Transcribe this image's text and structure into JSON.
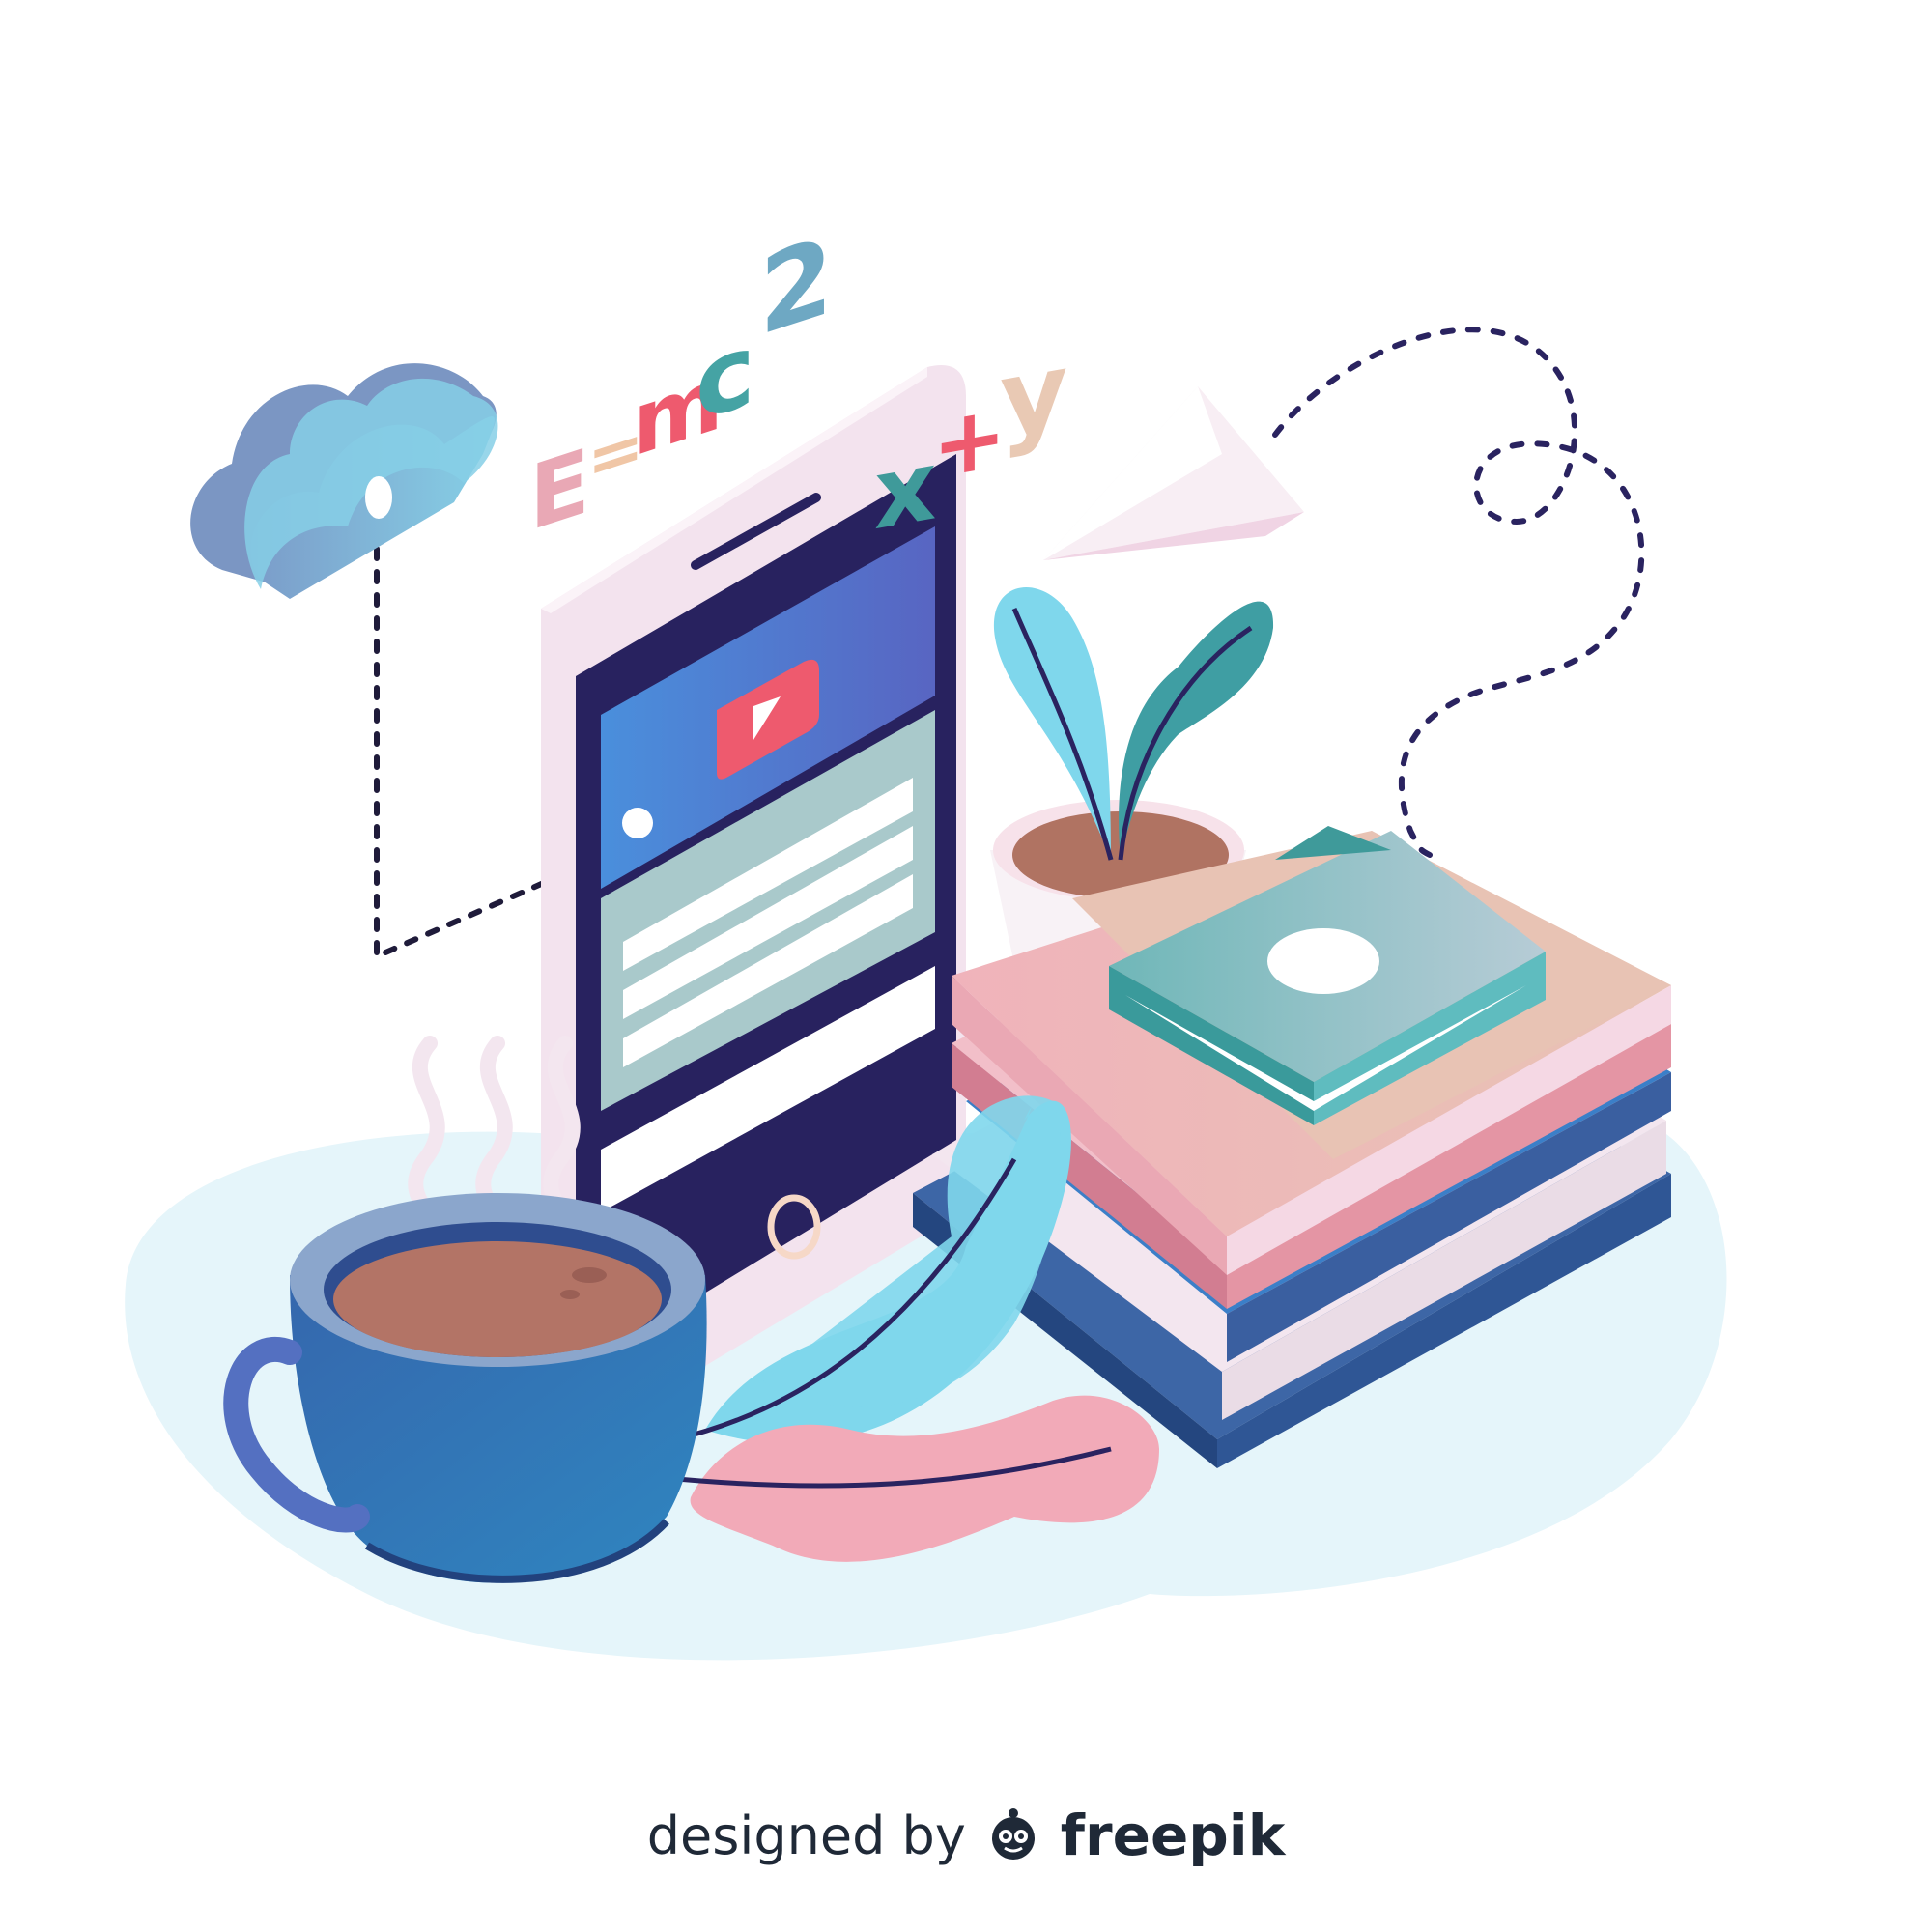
{
  "illustration": {
    "formula": {
      "e": "E",
      "equals": "=",
      "m": "m",
      "c": "c",
      "exponent": "2"
    },
    "expression": {
      "x": "x",
      "plus": "+",
      "y": "y"
    }
  },
  "credit": {
    "designed_by": "designed by",
    "brand": "freepik"
  },
  "colors": {
    "phone_frame": "#f4e6f0",
    "screen": "#2a2360",
    "video_header_start": "#4a8fdc",
    "video_header_end": "#5567c4",
    "play_button": "#ee5a6e",
    "cloud": "#7fc3e0",
    "cup": "#3a6ab2",
    "coffee": "#b37466",
    "book_teal": "#6fb9b9",
    "book_pink": "#f1b9c0",
    "book_blue": "#3a5fa0",
    "leaf_light": "#7fd7ec",
    "leaf_teal": "#3f9ea3",
    "leaf_pink": "#f2aab8",
    "floor": "#e6f5fa",
    "dotted_path": "#2a2360"
  }
}
